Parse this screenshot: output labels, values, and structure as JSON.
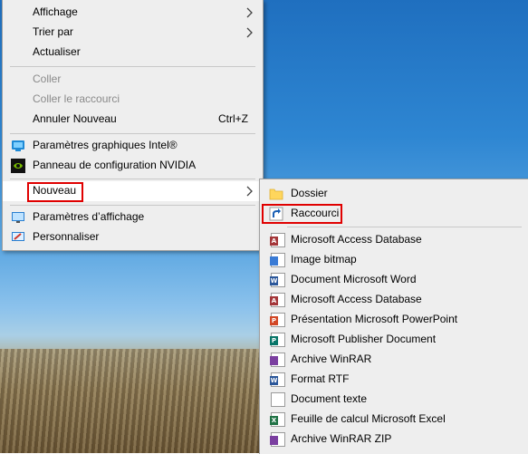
{
  "colors": {
    "highlight_box": "#e00000",
    "menu_bg": "#eeeeee"
  },
  "context_menu": {
    "view": "Affichage",
    "sort_by": "Trier par",
    "refresh": "Actualiser",
    "paste": "Coller",
    "paste_shortcut": "Coller le raccourci",
    "undo_new": "Annuler Nouveau",
    "undo_shortcut": "Ctrl+Z",
    "intel_graphics": "Paramètres graphiques Intel®",
    "nvidia_panel": "Panneau de configuration NVIDIA",
    "new": "Nouveau",
    "display_settings": "Paramètres d’affichage",
    "personalize": "Personnaliser"
  },
  "submenu": {
    "folder": "Dossier",
    "shortcut": "Raccourci",
    "items": [
      {
        "label": "Microsoft Access Database",
        "icon": "access-icon",
        "badge": "A",
        "color": "#a4373a"
      },
      {
        "label": "Image bitmap",
        "icon": "bitmap-icon",
        "badge": "",
        "color": "#3a7bd5"
      },
      {
        "label": "Document Microsoft Word",
        "icon": "word-icon",
        "badge": "W",
        "color": "#2b579a"
      },
      {
        "label": "Microsoft Access Database",
        "icon": "access-icon",
        "badge": "A",
        "color": "#a4373a"
      },
      {
        "label": "Présentation Microsoft PowerPoint",
        "icon": "powerpoint-icon",
        "badge": "P",
        "color": "#d24726"
      },
      {
        "label": "Microsoft Publisher Document",
        "icon": "publisher-icon",
        "badge": "P",
        "color": "#077568"
      },
      {
        "label": "Archive WinRAR",
        "icon": "winrar-icon",
        "badge": "",
        "color": "#7b3fa0"
      },
      {
        "label": "Format RTF",
        "icon": "rtf-icon",
        "badge": "W",
        "color": "#2b579a"
      },
      {
        "label": "Document texte",
        "icon": "text-document-icon",
        "badge": "",
        "color": "#ffffff"
      },
      {
        "label": "Feuille de calcul Microsoft Excel",
        "icon": "excel-icon",
        "badge": "X",
        "color": "#217346"
      },
      {
        "label": "Archive WinRAR ZIP",
        "icon": "winrar-zip-icon",
        "badge": "",
        "color": "#7b3fa0"
      }
    ]
  }
}
